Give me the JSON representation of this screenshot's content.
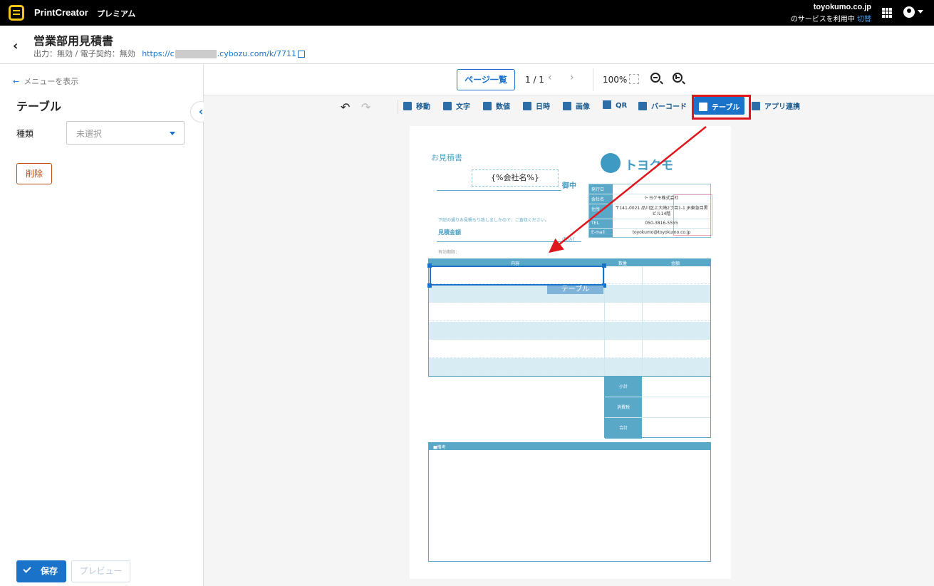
{
  "topbar": {
    "app_name": "PrintCreator",
    "plan": "プレミアム",
    "account_domain": "toyokumo.co.jp",
    "account_service": "のサービスを利用中",
    "account_switch": "切替"
  },
  "header": {
    "form_title": "営業部用見積書",
    "form_sub_status": "出力：無効 / 電子契約：無効",
    "url_prefix": "https://c",
    "url_suffix": ".cybozu.com/k/7711"
  },
  "sidebar": {
    "menu_link": "メニューを表示",
    "title": "テーブル",
    "kind_label": "種類",
    "kind_value": "未選択",
    "delete_label": "削除",
    "save_label": "保存",
    "preview_label": "プレビュー"
  },
  "pager": {
    "page_list_label": "ページ一覧",
    "page_indicator": "1 / 1",
    "zoom": "100%"
  },
  "toolbar": {
    "move": "移動",
    "text": "文字",
    "number": "数値",
    "datetime": "日時",
    "image": "画像",
    "qr": "QR",
    "barcode": "バーコード",
    "table": "テーブル",
    "app_link": "アプリ連携"
  },
  "paper": {
    "title": "お見積書",
    "company_placeholder": "{%会社名%}",
    "onchu": "御中",
    "logo_text": "トヨクモ",
    "info_rows": [
      {
        "key": "発行日",
        "value": ""
      },
      {
        "key": "会社名",
        "value": "トヨクモ株式会社"
      },
      {
        "key": "住所",
        "value": "〒141-0021 品川区上大崎2丁目1-1 JR東急目黒ビル14階"
      },
      {
        "key": "TEL",
        "value": "050-3816-5555"
      },
      {
        "key": "E-mail",
        "value": "toyokumo@toyokumo.co.jp"
      }
    ],
    "intro": "下記の通りお見積もり致しましたので、ご査収ください。",
    "amount_label": "見積金額",
    "tax_note": "(税込)",
    "valid_label": "有効期限：",
    "table_headers": {
      "content": "内容",
      "qty": "数量",
      "amount": "金額"
    },
    "selection_label": "テーブル",
    "summary": {
      "subtotal": "小計",
      "tax": "消費税",
      "total": "合計"
    },
    "remarks_label": "■備考"
  },
  "colors": {
    "accent": "#1a73c8",
    "paper_blue": "#5aa8c8",
    "highlight_red": "#e0161d",
    "delete_orange": "#c24a0e"
  }
}
